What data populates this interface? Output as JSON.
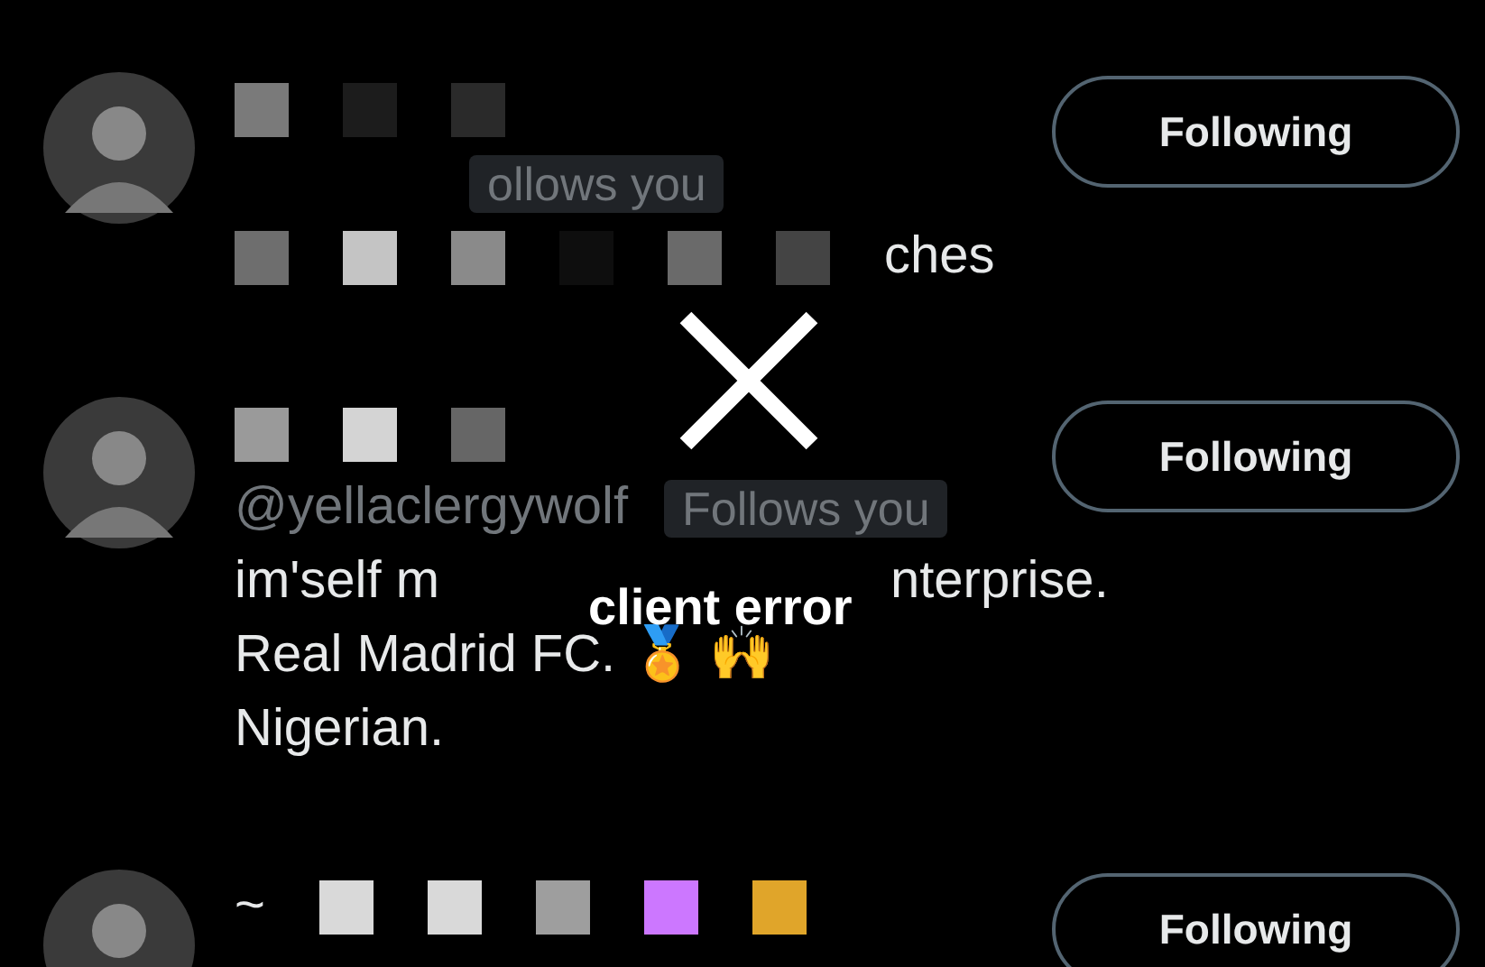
{
  "users": [
    {
      "name_blocks": [
        {
          "color": "#7a7a7a"
        },
        {
          "color": "#1c1c1c"
        },
        {
          "color": "#2a2a2a"
        }
      ],
      "badge": "ollows you",
      "bio": [
        {
          "blocks": [
            {
              "color": "#6e6e6e"
            },
            {
              "color": "#c4c4c4"
            },
            {
              "color": "#8a8a8a"
            },
            {
              "color": "#0e0e0e"
            },
            {
              "color": "#6a6a6a"
            },
            {
              "color": "#444444"
            }
          ],
          "texts": [
            "ches"
          ]
        }
      ],
      "button": "Following"
    },
    {
      "name_blocks": [
        {
          "color": "#9a9a9a"
        },
        {
          "color": "#d4d4d4"
        },
        {
          "color": "#666666"
        }
      ],
      "handle": "@yellaclergywolf",
      "badge": "Follows you",
      "bio": [
        {
          "texts": [
            "im'self m",
            "nterprise."
          ]
        },
        {
          "texts": [
            "Real Madrid FC. 🏅 🙌"
          ]
        },
        {
          "texts": [
            "Nigerian."
          ]
        }
      ],
      "button": "Following"
    },
    {
      "name_prefix": "~",
      "name_blocks": [
        {
          "color": "#d9d9d9"
        },
        {
          "color": "#d9d9d9"
        },
        {
          "color": "#9e9e9e"
        },
        {
          "color": "#cc77ff"
        },
        {
          "color": "#e0a52a"
        }
      ],
      "button": "Following"
    }
  ],
  "overlay": {
    "message": "client error"
  }
}
